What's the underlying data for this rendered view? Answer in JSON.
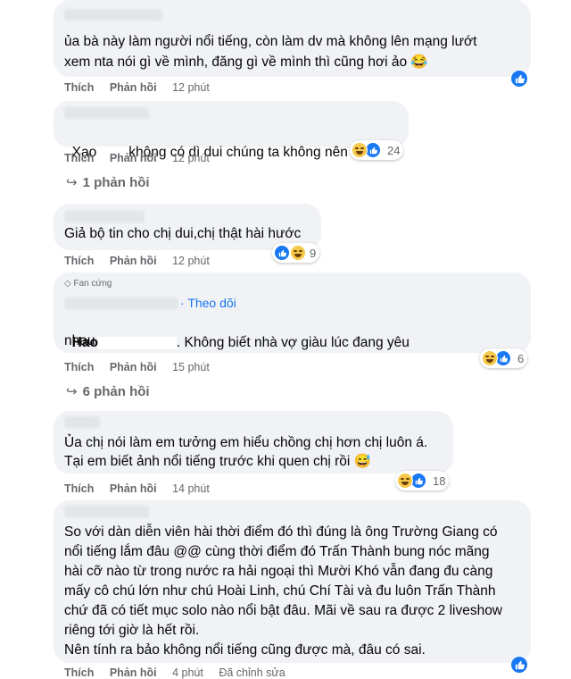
{
  "actions": {
    "like_label": "Thích",
    "reply_label": "Phản hồi"
  },
  "comments": [
    {
      "lines": [
        "ủa bà này làm người nổi tiếng, còn làm dv mà không lên mạng lướt",
        "xem nta nói gì về mình, đăng gì về mình thì cũng hơi ảo 😂"
      ],
      "time": "12 phút"
    },
    {
      "text_before": "Xạo",
      "text_after": "không có dì dui chúng ta không nên xạo",
      "time": "12 phút",
      "reaction_count": "24",
      "replies": "1 phản hồi"
    },
    {
      "text": "Giả bộ tin cho chị dui,chị thật hài hước",
      "time": "12 phút",
      "reaction_count": "9"
    },
    {
      "badge": "Fan cứng",
      "follow": "Theo dõi",
      "name_part": "Hao",
      "line1_after": ". Không biết nhà vợ giàu lúc đang yêu",
      "line2": "nhau",
      "time": "15 phút",
      "reaction_count": "6",
      "replies": "6 phản hồi"
    },
    {
      "lines": [
        "Ủa chị nói làm em tưởng em hiểu chồng chị hơn chị luôn á.",
        "Tại em biết ảnh nổi tiếng trước khi quen chị rồi 😅"
      ],
      "time": "14 phút",
      "reaction_count": "18"
    },
    {
      "lines": [
        "So với dàn diễn viên hài thời điểm đó thì đúng là ông Trường Giang có",
        "nổi tiếng lắm đâu @@ cùng thời điểm đó Trấn Thành bung nóc mãng",
        "hài cỡ nào từ trong nước ra hải ngoại thì Mười Khó vẫn đang đu càng",
        "mấy cô chú lớn như chú Hoài Linh, chú Chí Tài và đu luôn Trấn Thành",
        "chứ đã có tiết mục solo nào nổi bật đâu. Mãi về sau ra được 2 liveshow",
        "riêng tới giờ là hết rồi.",
        "Nên tính ra bảo không nổi tiếng cũng được mà, đâu có sai."
      ],
      "time": "4 phút",
      "edited": "Đã chỉnh sửa"
    }
  ]
}
